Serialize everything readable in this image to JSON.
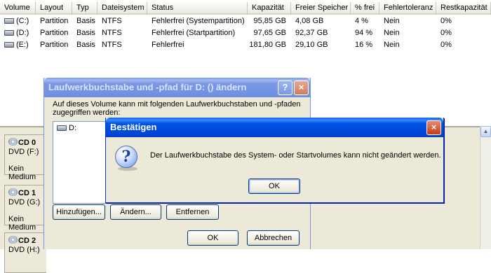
{
  "volume_table": {
    "columns": [
      "Volume",
      "Layout",
      "Typ",
      "Dateisystem",
      "Status",
      "Kapazität",
      "Freier Speicher",
      "% frei",
      "Fehlertoleranz",
      "Restkapazität"
    ],
    "rows": [
      {
        "volume": "(C:)",
        "layout": "Partition",
        "typ": "Basis",
        "fs": "NTFS",
        "status": "Fehlerfrei (Systempartition)",
        "kapazitaet": "95,85 GB",
        "frei": "4,08 GB",
        "pct": "4 %",
        "ft": "Nein",
        "rest": "0%"
      },
      {
        "volume": "(D:)",
        "layout": "Partition",
        "typ": "Basis",
        "fs": "NTFS",
        "status": "Fehlerfrei (Startpartition)",
        "kapazitaet": "97,65 GB",
        "frei": "92,37 GB",
        "pct": "94 %",
        "ft": "Nein",
        "rest": "0%"
      },
      {
        "volume": "(E:)",
        "layout": "Partition",
        "typ": "Basis",
        "fs": "NTFS",
        "status": "Fehlerfrei",
        "kapazitaet": "181,80 GB",
        "frei": "29,10 GB",
        "pct": "16 %",
        "ft": "Nein",
        "rest": "0%"
      }
    ]
  },
  "disks": [
    {
      "title": "CD 0",
      "drive": "DVD (F:)",
      "media": "Kein Medium"
    },
    {
      "title": "CD 1",
      "drive": "DVD (G:)",
      "media": "Kein Medium"
    },
    {
      "title": "CD 2",
      "drive": "DVD (H:)",
      "media": ""
    }
  ],
  "change_dialog": {
    "title": "Laufwerkbuchstabe und -pfad für D: () ändern",
    "help": "?",
    "close": "×",
    "description": "Auf dieses Volume kann mit folgenden Laufwerkbuchstaben und -pfaden zugegriffen werden:",
    "list_item": "D:",
    "add_button": "Hinzufügen...",
    "change_button": "Ändern...",
    "remove_button": "Entfernen",
    "ok_button": "OK",
    "cancel_button": "Abbrechen"
  },
  "confirm_dialog": {
    "title": "Bestätigen",
    "close": "×",
    "icon": "question-icon",
    "message": "Der Laufwerkbuchstabe des System- oder Startvolumes kann nicht geändert werden.",
    "ok_button": "OK"
  },
  "colors": {
    "titlebar_active": "#0055e5",
    "titlebar_inactive": "#7c98e4",
    "dialog_bg": "#ece9d8"
  }
}
